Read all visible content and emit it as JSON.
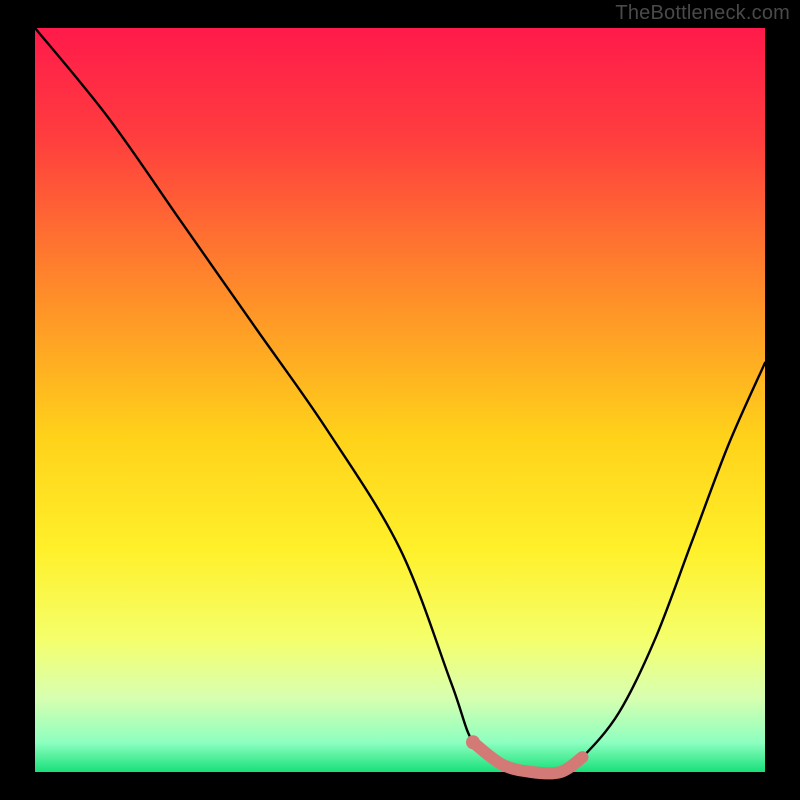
{
  "watermark": "TheBottleneck.com",
  "chart_data": {
    "type": "line",
    "title": "",
    "xlabel": "",
    "ylabel": "",
    "xlim": [
      0,
      100
    ],
    "ylim": [
      0,
      100
    ],
    "gradient_stops": [
      {
        "pct": 0,
        "color": "#ff1a4b"
      },
      {
        "pct": 15,
        "color": "#ff3e3e"
      },
      {
        "pct": 35,
        "color": "#ff8a2a"
      },
      {
        "pct": 55,
        "color": "#ffd21a"
      },
      {
        "pct": 70,
        "color": "#fff02a"
      },
      {
        "pct": 82,
        "color": "#f5ff6a"
      },
      {
        "pct": 90,
        "color": "#d8ffb0"
      },
      {
        "pct": 96,
        "color": "#8effc0"
      },
      {
        "pct": 100,
        "color": "#18e07a"
      }
    ],
    "series": [
      {
        "name": "bottleneck-curve",
        "color": "#000000",
        "x": [
          0,
          10,
          20,
          30,
          40,
          50,
          57,
          60,
          64,
          68,
          72,
          75,
          80,
          85,
          90,
          95,
          100
        ],
        "y": [
          100,
          88,
          74,
          60,
          46,
          30,
          12,
          4,
          1,
          0,
          0,
          2,
          8,
          18,
          31,
          44,
          55
        ]
      }
    ],
    "highlight_segment": {
      "name": "optimal-range",
      "color": "#d37a77",
      "x": [
        60,
        64,
        68,
        72,
        75
      ],
      "y": [
        4,
        1,
        0,
        0,
        2
      ]
    },
    "marker_point": {
      "x": 60,
      "y": 4,
      "color": "#d37a77"
    }
  }
}
